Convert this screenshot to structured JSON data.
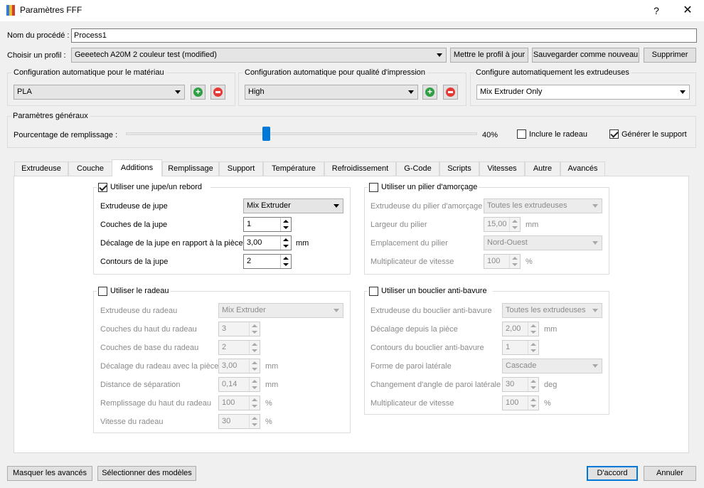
{
  "window": {
    "title": "Paramètres FFF",
    "help": "?",
    "close": "✕"
  },
  "process": {
    "label": "Nom du procédé :",
    "value": "Process1"
  },
  "profile": {
    "label": "Choisir un profil :",
    "value": "Geeetech A20M 2 couleur test (modified)",
    "update_btn": "Mettre le profil à jour",
    "save_btn": "Sauvegarder comme nouveau",
    "delete_btn": "Supprimer"
  },
  "auto_material": {
    "title": "Configuration automatique pour le matériau",
    "value": "PLA"
  },
  "auto_quality": {
    "title": "Configuration automatique pour qualité d'impression",
    "value": "High"
  },
  "auto_extruders": {
    "title": "Configure automatiquement les extrudeuses",
    "value": "Mix Extruder Only"
  },
  "general": {
    "title": "Paramètres généraux",
    "infill_label": "Pourcentage de remplissage :",
    "infill_value": "40%",
    "infill_fraction": 0.4,
    "raft_label": "Inclure le radeau",
    "raft_checked": false,
    "support_label": "Générer le support",
    "support_checked": true
  },
  "tabs": [
    "Extrudeuse",
    "Couche",
    "Additions",
    "Remplissage",
    "Support",
    "Température",
    "Refroidissement",
    "G-Code",
    "Scripts",
    "Vitesses",
    "Autre",
    "Avancés"
  ],
  "active_tab": "Additions",
  "skirt": {
    "title": "Utiliser une jupe/un rebord",
    "checked": true,
    "extruder_label": "Extrudeuse de jupe",
    "extruder_value": "Mix Extruder",
    "layers_label": "Couches de la jupe",
    "layers_value": "1",
    "offset_label": "Décalage de la jupe en rapport à la pièce",
    "offset_value": "3,00",
    "offset_unit": "mm",
    "outlines_label": "Contours de la jupe",
    "outlines_value": "2"
  },
  "prime": {
    "title": "Utiliser un pilier d'amorçage",
    "checked": false,
    "extruder_label": "Extrudeuse du pilier d'amorçage",
    "extruder_value": "Toutes les extrudeuses",
    "width_label": "Largeur du pilier",
    "width_value": "15,00",
    "width_unit": "mm",
    "location_label": "Emplacement du pilier",
    "location_value": "Nord-Ouest",
    "speed_label": "Multiplicateur de vitesse",
    "speed_value": "100",
    "speed_unit": "%"
  },
  "raft": {
    "title": "Utiliser le radeau",
    "checked": false,
    "extruder_label": "Extrudeuse du radeau",
    "extruder_value": "Mix Extruder",
    "top_label": "Couches du haut du radeau",
    "top_value": "3",
    "base_label": "Couches de base du radeau",
    "base_value": "2",
    "offset_label": "Décalage du radeau avec la pièce",
    "offset_value": "3,00",
    "offset_unit": "mm",
    "sep_label": "Distance de séparation",
    "sep_value": "0,14",
    "sep_unit": "mm",
    "infill_label": "Remplissage du haut du radeau",
    "infill_value": "100",
    "infill_unit": "%",
    "speed_label": "Vitesse du radeau",
    "speed_value": "30",
    "speed_unit": "%"
  },
  "shield": {
    "title": "Utiliser un bouclier anti-bavure",
    "checked": false,
    "extruder_label": "Extrudeuse du bouclier anti-bavure",
    "extruder_value": "Toutes les extrudeuses",
    "offset_label": "Décalage depuis la pièce",
    "offset_value": "2,00",
    "offset_unit": "mm",
    "outlines_label": "Contours du bouclier anti-bavure",
    "outlines_value": "1",
    "wall_label": "Forme de paroi latérale",
    "wall_value": "Cascade",
    "angle_label": "Changement d'angle de paroi latérale",
    "angle_value": "30",
    "angle_unit": "deg",
    "speed_label": "Multiplicateur de vitesse",
    "speed_value": "100",
    "speed_unit": "%"
  },
  "footer": {
    "hide_advanced": "Masquer les avancés",
    "select_models": "Sélectionner des modèles",
    "ok": "D'accord",
    "cancel": "Annuler"
  },
  "colors": {
    "accent": "#0078d7",
    "add": "#2ea043",
    "remove": "#e53935"
  }
}
